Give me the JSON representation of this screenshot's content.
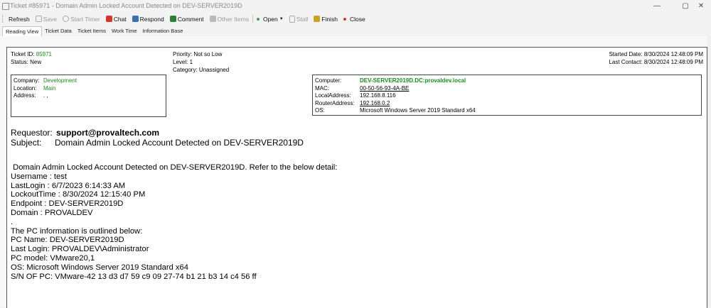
{
  "window": {
    "title": "Ticket #85971 - Domain Admin Locked Account Detected on DEV-SERVER2019D",
    "min": "—",
    "max": "▢",
    "close": "✕"
  },
  "toolbar": {
    "refresh": "Refresh",
    "save": "Save",
    "start_timer": "Start Timer",
    "chat": "Chat",
    "respond": "Respond",
    "comment": "Comment",
    "other_items": "Other Items",
    "open": "Open",
    "stall": "Stall",
    "finish": "Finish",
    "close": "Close"
  },
  "tabs": [
    "Reading View",
    "Ticket Data",
    "Ticket Items",
    "Work Time",
    "Information Base"
  ],
  "ticket": {
    "id_label": "Ticket ID:",
    "id": "85971",
    "status_label": "Status:",
    "status": "New",
    "priority_label": "Priority:",
    "priority": "Not so Low",
    "level_label": "Level:",
    "level": "1",
    "category_label": "Category:",
    "category": "Unassigned",
    "started_label": "Started Date:",
    "started": "8/30/2024 12:48:09 PM",
    "contact_label": "Last Contact:",
    "contact": "8/30/2024 12:48:09 PM"
  },
  "company": {
    "company_label": "Company:",
    "company": "Development",
    "location_label": "Location:",
    "location": "Main",
    "address_label": "Address:",
    "address": ". ,"
  },
  "computer": {
    "computer_label": "Computer:",
    "computer": "DEV-SERVER2019D.DC:provaldev.local",
    "mac_label": "MAC:",
    "mac": "00-50-56-93-4A-BE",
    "local_label": "LocalAddress:",
    "local": "192.168.8.116",
    "router_label": "RouterAddress:",
    "router": "192.168.0.2",
    "os_label": "OS:",
    "os": "Microsoft Windows Server 2019 Standard x64"
  },
  "request": {
    "requestor_label": "Requestor:",
    "requestor": "support@provaltech.com",
    "subject_label": "Subject:",
    "subject": "Domain Admin Locked Account Detected on DEV-SERVER2019D"
  },
  "body": " Domain Admin Locked Account Detected on DEV-SERVER2019D. Refer to the below detail:\nUsername : test\nLastLogin : 6/7/2023 6:14:33 AM\nLockoutTime : 8/30/2024 12:15:40 PM\nEndpoint : DEV-SERVER2019D\nDomain : PROVALDEV\n.\nThe PC information is outlined below:\nPC Name: DEV-SERVER2019D\nLast Login: PROVALDEV\\Administrator\nPC model: VMware20,1\nOS: Microsoft Windows Server 2019 Standard x64\nS/N OF PC: VMware-42 13 d3 d7 59 c9 09 27-74 b1 21 b3 14 c4 56 ff"
}
